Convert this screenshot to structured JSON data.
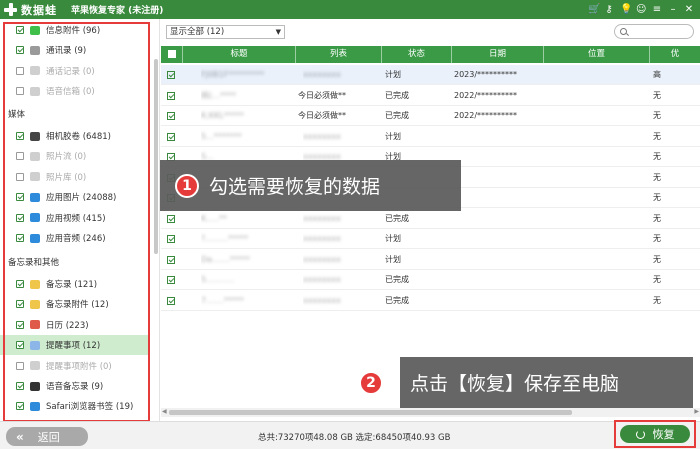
{
  "titlebar": {
    "brand": "数据蛙",
    "title": "苹果恢复专家 (未注册)",
    "icons": [
      "cart-icon",
      "key-icon",
      "lightbulb-icon",
      "chat-icon",
      "menu-icon",
      "minimize-icon",
      "close-icon"
    ],
    "icon_glyphs": [
      "🛒",
      "⚷",
      "💡",
      "☺",
      "≡",
      "–",
      "✕"
    ]
  },
  "sidebar": {
    "top_items": [
      {
        "label": "信息附件 (96)",
        "checked": true,
        "disabled": false,
        "color": "#3fbf4a"
      },
      {
        "label": "通讯录 (9)",
        "checked": true,
        "disabled": false,
        "color": "#9a9a9a"
      },
      {
        "label": "通话记录 (0)",
        "checked": false,
        "disabled": true,
        "color": "#cfcfcf"
      },
      {
        "label": "语音信箱 (0)",
        "checked": false,
        "disabled": true,
        "color": "#cfcfcf"
      }
    ],
    "media_heading": "媒体",
    "media_items": [
      {
        "label": "相机胶卷 (6481)",
        "checked": true,
        "disabled": false,
        "color": "#444"
      },
      {
        "label": "照片流 (0)",
        "checked": false,
        "disabled": true,
        "color": "#cfcfcf"
      },
      {
        "label": "照片库 (0)",
        "checked": false,
        "disabled": true,
        "color": "#cfcfcf"
      },
      {
        "label": "应用图片 (24088)",
        "checked": true,
        "disabled": false,
        "color": "#2e8bdc"
      },
      {
        "label": "应用视频 (415)",
        "checked": true,
        "disabled": false,
        "color": "#2e8bdc"
      },
      {
        "label": "应用音频 (246)",
        "checked": true,
        "disabled": false,
        "color": "#2e8bdc"
      }
    ],
    "memo_heading": "备忘录和其他",
    "memo_items": [
      {
        "label": "备忘录 (121)",
        "checked": true,
        "disabled": false,
        "color": "#f0c64a"
      },
      {
        "label": "备忘录附件 (12)",
        "checked": true,
        "disabled": false,
        "color": "#f0c64a"
      },
      {
        "label": "日历 (223)",
        "checked": true,
        "disabled": false,
        "color": "#e05a4a"
      },
      {
        "label": "提醒事项 (12)",
        "checked": true,
        "disabled": false,
        "color": "#8db6e8",
        "selected": true
      },
      {
        "label": "提醒事项附件 (0)",
        "checked": false,
        "disabled": true,
        "color": "#cfcfcf"
      },
      {
        "label": "语音备忘录 (9)",
        "checked": true,
        "disabled": false,
        "color": "#333"
      },
      {
        "label": "Safari浏览器书签 (19)",
        "checked": true,
        "disabled": false,
        "color": "#2e8bdc"
      }
    ]
  },
  "main": {
    "filter_value": "显示全部 (12)",
    "search_placeholder": "",
    "columns": [
      "标题",
      "列表",
      "状态",
      "日期",
      "位置",
      "优"
    ],
    "rows": [
      {
        "title": "FJ0B1F*********",
        "list": "",
        "status": "计划",
        "date": "2023/**********",
        "loc": "",
        "pri": "高",
        "list_blur": "xxxxxxxx"
      },
      {
        "title": "桃(…****",
        "list": "今日必须做**",
        "status": "已完成",
        "date": "2022/**********",
        "loc": "",
        "pri": "无"
      },
      {
        "title": "K;KKL*****",
        "list": "今日必须做**",
        "status": "已完成",
        "date": "2022/**********",
        "loc": "",
        "pri": "无"
      },
      {
        "title": "5...*******",
        "list": "",
        "status": "计划",
        "date": "",
        "loc": "",
        "pri": "无",
        "list_blur": "xxxxxxxx"
      },
      {
        "title": "S...",
        "list": "",
        "status": "计划",
        "date": "",
        "loc": "",
        "pri": "无",
        "list_blur": "xxxxxxxx"
      },
      {
        "title": "",
        "list": "",
        "status": "",
        "date": "",
        "loc": "",
        "pri": "无"
      },
      {
        "title": "",
        "list": "",
        "status": "",
        "date": "",
        "loc": "",
        "pri": "无"
      },
      {
        "title": "K.....**",
        "list": "",
        "status": "已完成",
        "date": "",
        "loc": "",
        "pri": "无",
        "list_blur": "xxxxxxxx"
      },
      {
        "title": "?.........*****",
        "list": "",
        "status": "计划",
        "date": "",
        "loc": "",
        "pri": "无",
        "list_blur": "xxxxxxxx"
      },
      {
        "title": "Da.......*****",
        "list": "",
        "status": "计划",
        "date": "",
        "loc": "",
        "pri": "无",
        "list_blur": "xxxxxxxx"
      },
      {
        "title": "5...........",
        "list": "",
        "status": "已完成",
        "date": "",
        "loc": "",
        "pri": "无",
        "list_blur": "xxxxxxxx"
      },
      {
        "title": "7.......*****",
        "list": "",
        "status": "已完成",
        "date": "",
        "loc": "",
        "pri": "无",
        "list_blur": "xxxxxxxx"
      }
    ]
  },
  "tips": {
    "step1_num": "1",
    "step1_text": "勾选需要恢复的数据",
    "step2_num": "2",
    "step2_text": "点击【恢复】保存至电脑"
  },
  "footer": {
    "back_label": "返回",
    "stats": "总共:73270项48.08 GB 选定:68450项40.93 GB",
    "recover_label": "恢复"
  },
  "colors": {
    "accent": "#3a8a3e",
    "header": "#3a9a46",
    "highlight": "#e63b3b"
  }
}
